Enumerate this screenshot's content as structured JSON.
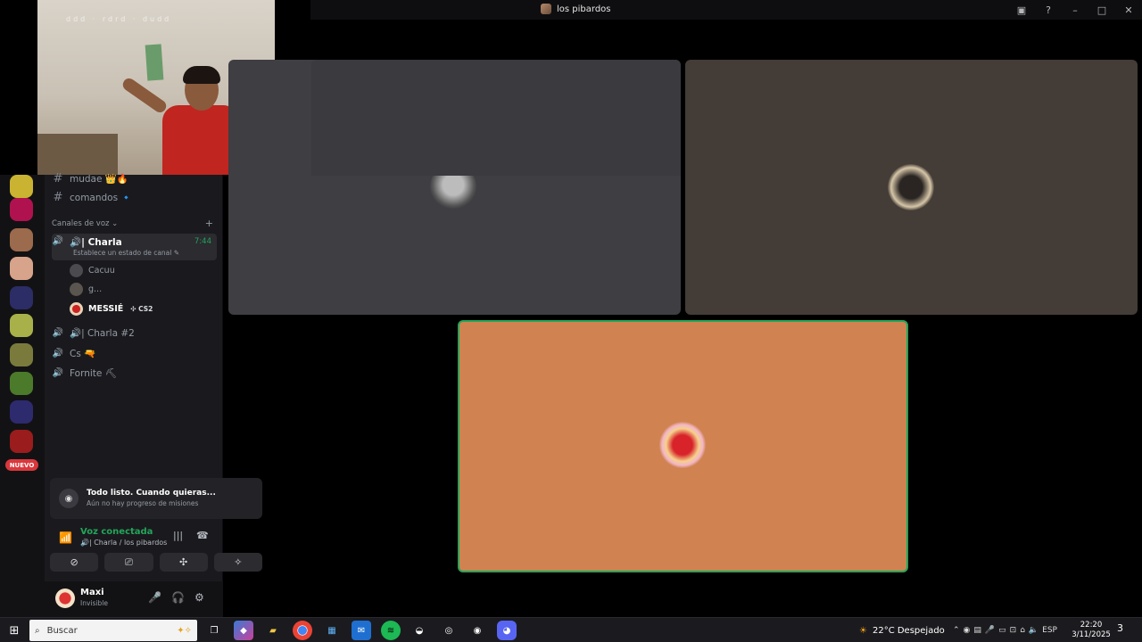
{
  "window": {
    "title": "los pibardos",
    "buttons": [
      "inbox-icon",
      "help-icon",
      "minimize-icon",
      "maximize-icon",
      "close-icon"
    ]
  },
  "webcam": {
    "watermark": "ddd  ·  rdrd  ·  dudd"
  },
  "servers": {
    "new_badge": "NUEVO"
  },
  "text_channels": [
    {
      "name": "mudae 👑🔥"
    },
    {
      "name": "comandos 🔹"
    }
  ],
  "voice_category": {
    "label": "Canales de voz ⌄",
    "add": "+"
  },
  "voice_channels": [
    {
      "name": "🔊| Charla",
      "timer": "7:44",
      "status": "Establece un estado de canal ✎",
      "active": true,
      "users": [
        {
          "name": "Cacuu"
        },
        {
          "name": "g..."
        },
        {
          "name": "MESSIÉ",
          "game": "✣ CS2"
        }
      ]
    },
    {
      "name": "🔊| Charla #2"
    },
    {
      "name": "Cs 🔫"
    },
    {
      "name": "Fornite ⛏"
    }
  ],
  "quest": {
    "title": "Todo listo. Cuando quieras...",
    "subtitle": "Aún no hay progreso de misiones"
  },
  "voice_status": {
    "title": "Voz conectada",
    "subtitle": "🔊| Charla / los pibardos"
  },
  "user_panel": {
    "name": "Maxi",
    "status": "Invisible"
  },
  "colors": {
    "connected": "#23a55a",
    "speaking_border": "#23a55a",
    "tile3_bg": "#d08350",
    "nuevo": "#da373c"
  },
  "taskbar": {
    "search_placeholder": "Buscar",
    "weather": "22°C  Despejado",
    "lang": "ESP",
    "time": "22:20",
    "date": "3/11/2025",
    "notifications": "3"
  }
}
